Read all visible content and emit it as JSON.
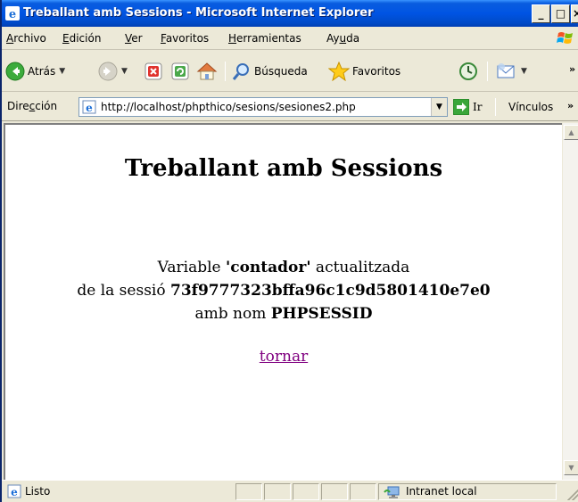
{
  "window": {
    "title": "Treballant amb Sessions - Microsoft Internet Explorer",
    "minimize": "_",
    "maximize": "□",
    "close": "×"
  },
  "menu": {
    "items": [
      {
        "first": "A",
        "rest": "rchivo"
      },
      {
        "first": "E",
        "rest": "dición"
      },
      {
        "first": "V",
        "rest": "er"
      },
      {
        "first": "F",
        "rest": "avoritos"
      },
      {
        "first": "H",
        "rest": "erramientas"
      },
      {
        "pre": "Ay",
        "first": "u",
        "rest": "da"
      }
    ]
  },
  "toolbar": {
    "back_label": "Atrás",
    "search_label": "Búsqueda",
    "favorites_label": "Favoritos",
    "overflow": "»"
  },
  "address": {
    "label_pre": "Dire",
    "label_u": "c",
    "label_post": "ción",
    "url": "http://localhost/phpthico/sesions/sesiones2.php",
    "go_label": "Ir",
    "links_label": "Vínculos",
    "links_overflow": "»"
  },
  "page": {
    "title": "Treballant amb Sessions",
    "line1_pre": "Variable ",
    "line1_bold": "'contador'",
    "line1_post": " actualitzada",
    "line2_pre": "de la sessió ",
    "line2_bold": "73f9777323bffa96c1c9d5801410e7e0",
    "line3_pre": "amb nom ",
    "line3_bold": "PHPSESSID",
    "link_text": "tornar"
  },
  "status": {
    "text": "Listo",
    "zone": "Intranet local"
  },
  "colors": {
    "titlebar": "#0054e3",
    "chrome": "#ece9d8",
    "visited_link": "#800080"
  },
  "icons": {
    "title": "ie-icon",
    "back": "back-arrow-icon",
    "forward": "forward-arrow-icon",
    "stop": "stop-icon",
    "refresh": "refresh-icon",
    "home": "home-icon",
    "search": "search-icon",
    "favorites": "star-icon",
    "history": "history-icon",
    "mail": "mail-icon"
  }
}
